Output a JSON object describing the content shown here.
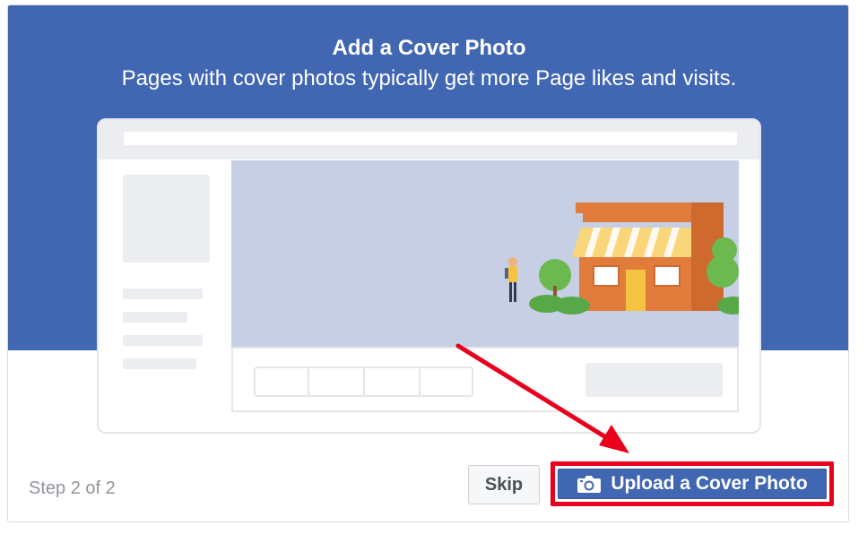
{
  "dialog": {
    "title": "Add a Cover Photo",
    "subtitle": "Pages with cover photos typically get more Page likes and visits."
  },
  "footer": {
    "step_text": "Step 2 of 2",
    "skip_label": "Skip",
    "upload_label": "Upload a Cover Photo"
  },
  "icons": {
    "upload_icon": "camera-icon"
  },
  "colors": {
    "brand_blue": "#4267b2",
    "highlight_red": "#e8001c",
    "cover_placeholder": "#c6cfe4"
  }
}
